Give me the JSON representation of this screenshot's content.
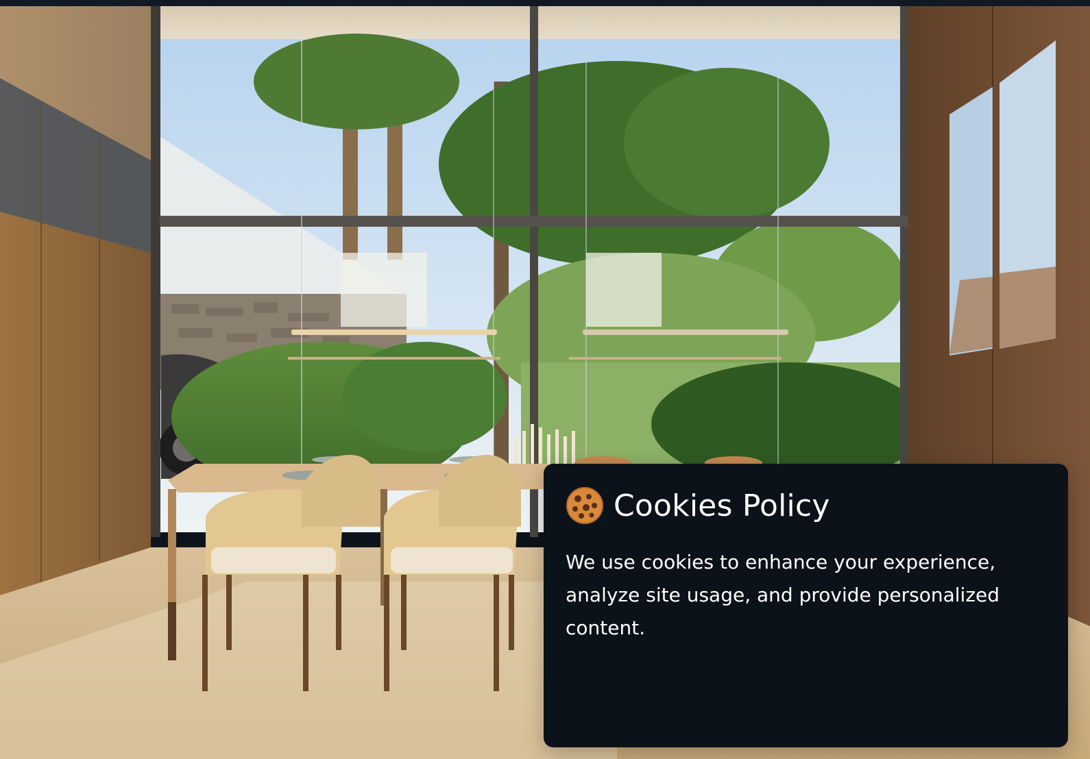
{
  "hero": {
    "image_description": "modern dining room with floor-to-ceiling window overlooking tropical garden"
  },
  "cookie_banner": {
    "title": "Cookies Policy",
    "message": "We use cookies to enhance your experience, analyze site usage, and provide personalized content.",
    "icon": "cookie-icon"
  },
  "colors": {
    "panel_bg": "#0c121a",
    "text": "#ffffff",
    "top_bar": "#111a24"
  }
}
